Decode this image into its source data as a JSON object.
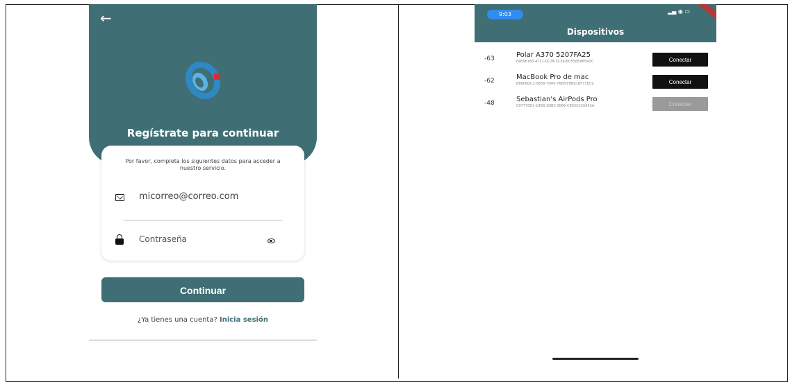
{
  "signup": {
    "back_icon": "arrow-left-icon",
    "title": "Regístrate para continuar",
    "description": "Por favor, completa los siguientes datos para acceder a nuestro servicio.",
    "email_value": "micorreo@correo.com",
    "password_placeholder": "Contraseña",
    "continue_label": "Continuar",
    "login_prompt": "¿Ya tienes una cuenta?",
    "login_link": "Inicia sesión",
    "accent_color": "#3f6f74"
  },
  "devices": {
    "status_time": "9:03",
    "title": "Dispositivos",
    "items": [
      {
        "rssi": "-63",
        "name": "Polar A370 5207FA25",
        "id": "F4EAE180-4721-0C28-3C3A-6D556B4859DC",
        "button": "Conectar",
        "enabled": true
      },
      {
        "rssi": "-62",
        "name": "MacBook Pro de mac",
        "id": "B6606DC1-5858-7D00-76EB-F8B61BF71EC9",
        "button": "Conectar",
        "enabled": true
      },
      {
        "rssi": "-48",
        "name": "Sebastian's AirPods Pro",
        "id": "C97770D1-145B-3DB0-3066-C96321CA342A",
        "button": "Conectar",
        "enabled": false
      }
    ]
  }
}
